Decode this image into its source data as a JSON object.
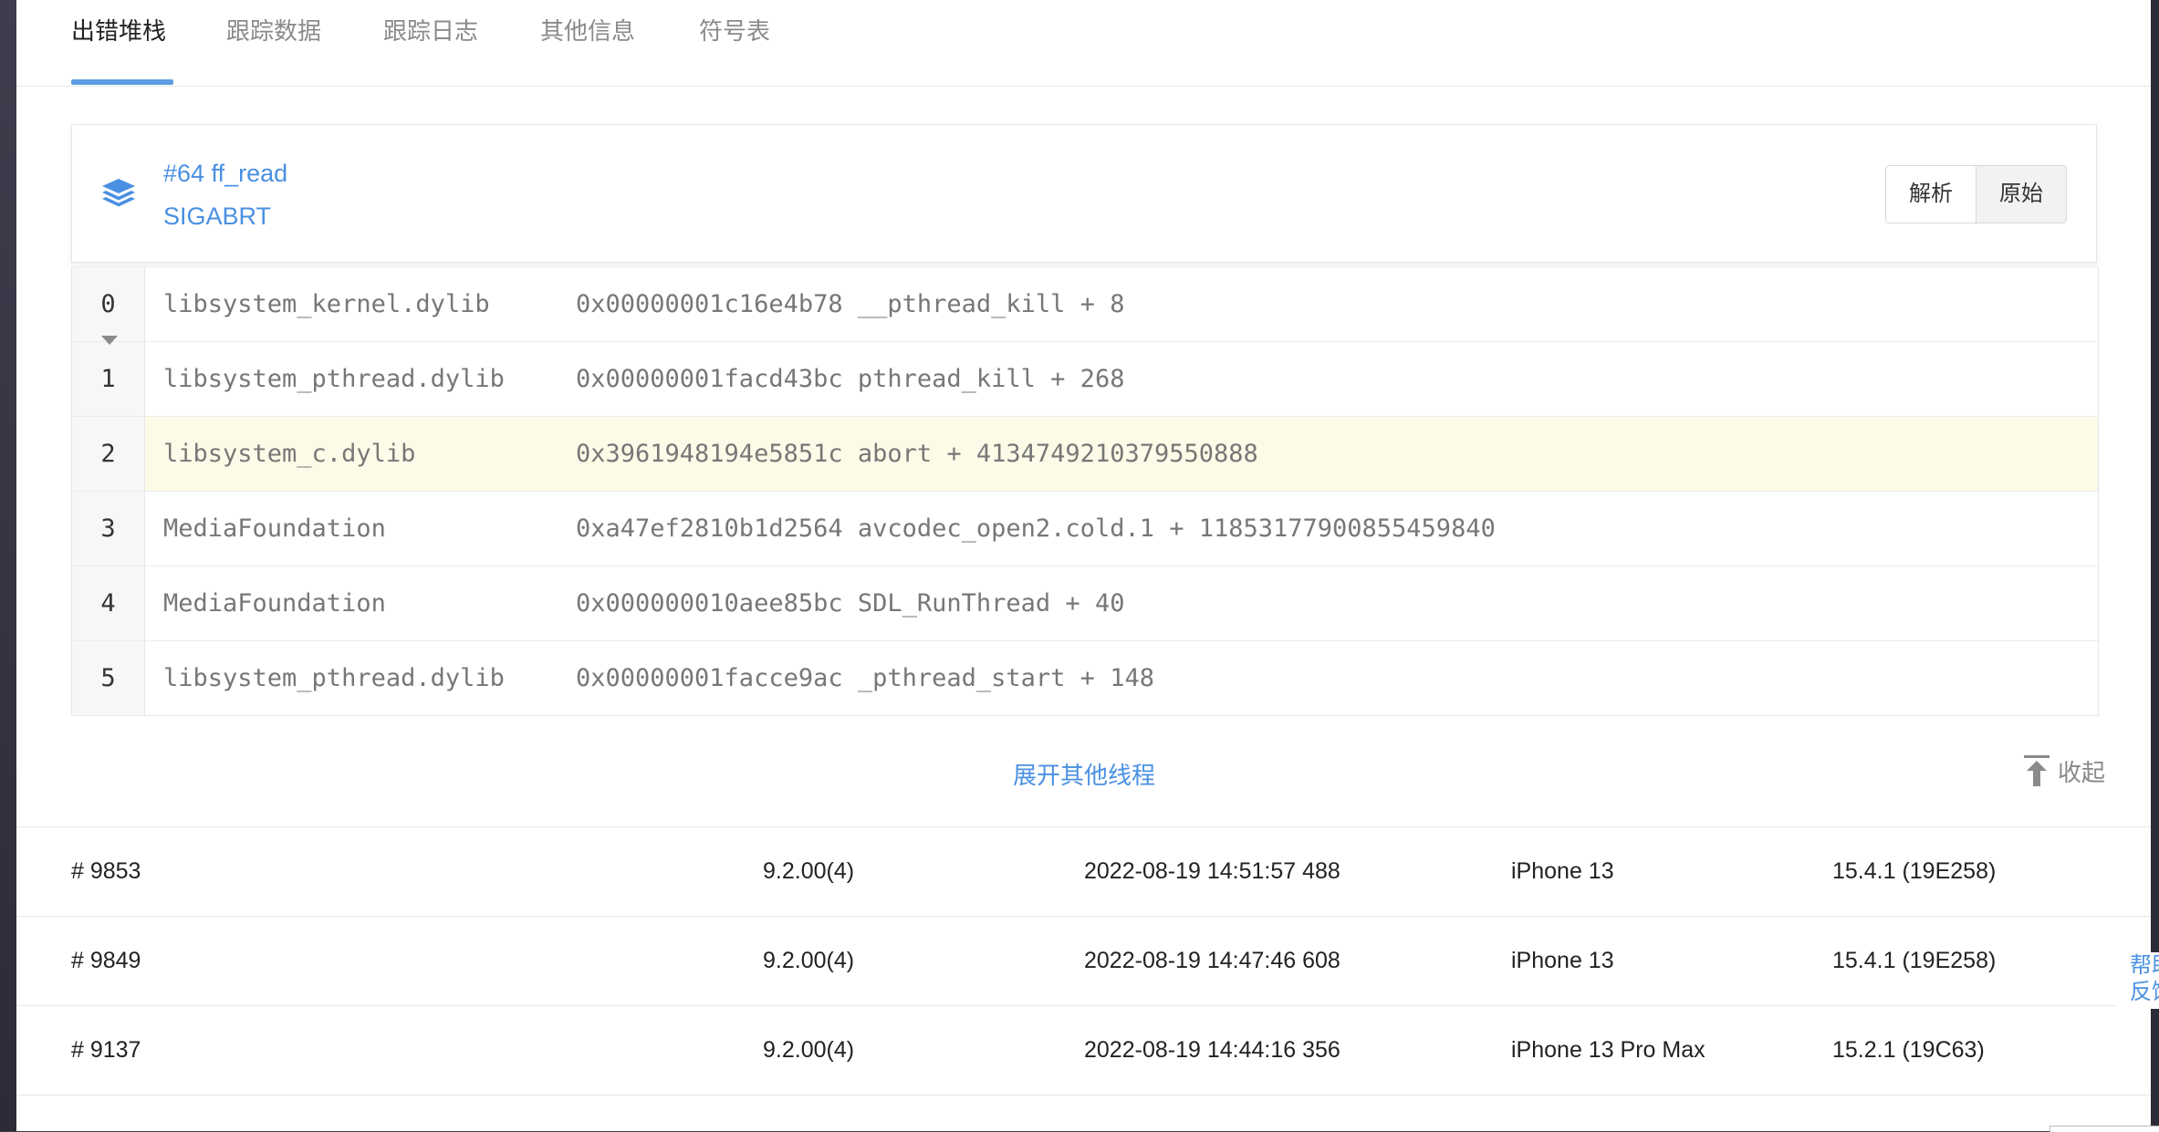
{
  "tabs": [
    "出错堆栈",
    "跟踪数据",
    "跟踪日志",
    "其他信息",
    "符号表"
  ],
  "stack": {
    "title": "#64 ff_read",
    "signal": "SIGABRT",
    "buttons": [
      "解析",
      "原始"
    ],
    "active_button": "原始",
    "frames": [
      {
        "index": "0",
        "library": "libsystem_kernel.dylib",
        "address": "0x00000001c16e4b78 __pthread_kill + 8"
      },
      {
        "index": "1",
        "library": "libsystem_pthread.dylib",
        "address": "0x00000001facd43bc pthread_kill + 268"
      },
      {
        "index": "2",
        "library": "libsystem_c.dylib",
        "address": "0x3961948194e5851c abort + 4134749210379550888"
      },
      {
        "index": "3",
        "library": "MediaFoundation",
        "address": "0xa47ef2810b1d2564 avcodec_open2.cold.1 + 11853177900855459840"
      },
      {
        "index": "4",
        "library": "MediaFoundation",
        "address": "0x000000010aee85bc SDL_RunThread + 40"
      },
      {
        "index": "5",
        "library": "libsystem_pthread.dylib",
        "address": "0x00000001facce9ac _pthread_start + 148"
      }
    ],
    "highlighted_frame": "2",
    "expand_label": "展开其他线程",
    "collapse_label": "收起"
  },
  "crashes": [
    {
      "id": "# 9853",
      "version": "9.2.00(4)",
      "time": "2022-08-19 14:51:57 488",
      "model": "iPhone 13",
      "os": "15.4.1 (19E258)"
    },
    {
      "id": "# 9849",
      "version": "9.2.00(4)",
      "time": "2022-08-19 14:47:46 608",
      "model": "iPhone 13",
      "os": "15.4.1 (19E258)"
    },
    {
      "id": "# 9137",
      "version": "9.2.00(4)",
      "time": "2022-08-19 14:44:16 356",
      "model": "iPhone 13 Pro Max",
      "os": "15.2.1 (19C63)"
    }
  ],
  "help": {
    "line1": "帮助",
    "line2": "反馈"
  },
  "colors": {
    "accent": "#4a90e2",
    "tab_ink": "#5b9de0",
    "highlight_row": "#fdfbe7"
  },
  "icons": {
    "stack": "layers-icon",
    "collapse": "collapse-up-icon",
    "expand_caret": "caret-down-icon"
  }
}
